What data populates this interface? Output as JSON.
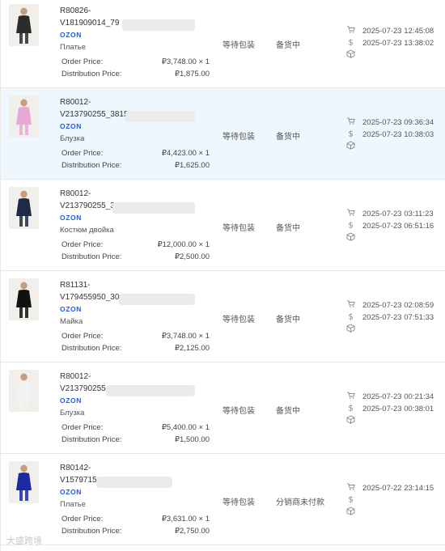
{
  "watermark": "大盛跨境",
  "orders": [
    {
      "sku_line1": "R80826-",
      "sku_line2": "V181909014_79",
      "platform": "OZON",
      "product_type": "Платье",
      "order_price_label": "Order Price:",
      "order_price": "₽3,748.00 × 1",
      "dist_price_label": "Distribution Price:",
      "dist_price": "₽1,875.00",
      "status": "等待包装",
      "stock_status": "备货中",
      "time_1": "2025-07-23 12:45:08",
      "time_2": "2025-07-23 13:38:02",
      "thumb_color": "#2b2b2b",
      "highlighted": false
    },
    {
      "sku_line1": "R80012-",
      "sku_line2": "V213790255_3815",
      "platform": "OZON",
      "product_type": "Блузка",
      "order_price_label": "Order Price:",
      "order_price": "₽4,423.00 × 1",
      "dist_price_label": "Distribution Price:",
      "dist_price": "₽1,625.00",
      "status": "等待包装",
      "stock_status": "备货中",
      "time_1": "2025-07-23 09:36:34",
      "time_2": "2025-07-23 10:38:03",
      "thumb_color": "#e7a9d4",
      "highlighted": true
    },
    {
      "sku_line1": "R80012-",
      "sku_line2": "V213790255_3",
      "platform": "OZON",
      "product_type": "Костюм двойка",
      "order_price_label": "Order Price:",
      "order_price": "₽12,000.00 × 1",
      "dist_price_label": "Distribution Price:",
      "dist_price": "₽2,500.00",
      "status": "等待包装",
      "stock_status": "备货中",
      "time_1": "2025-07-23 03:11:23",
      "time_2": "2025-07-23 06:51:16",
      "thumb_color": "#1f2a44",
      "highlighted": false
    },
    {
      "sku_line1": "R81131-",
      "sku_line2": "V179455950_30",
      "platform": "OZON",
      "product_type": "Майка",
      "order_price_label": "Order Price:",
      "order_price": "₽3,748.00 × 1",
      "dist_price_label": "Distribution Price:",
      "dist_price": "₽2,125.00",
      "status": "等待包装",
      "stock_status": "备货中",
      "time_1": "2025-07-23 02:08:59",
      "time_2": "2025-07-23 07:51:33",
      "thumb_color": "#111111",
      "highlighted": false
    },
    {
      "sku_line1": "R80012-",
      "sku_line2": "V213790255",
      "platform": "OZON",
      "product_type": "Блузка",
      "order_price_label": "Order Price:",
      "order_price": "₽5,400.00 × 1",
      "dist_price_label": "Distribution Price:",
      "dist_price": "₽1,500.00",
      "status": "等待包装",
      "stock_status": "备货中",
      "time_1": "2025-07-23 00:21:34",
      "time_2": "2025-07-23 00:38:01",
      "thumb_color": "#f2f2f2",
      "highlighted": false
    },
    {
      "sku_line1": "R80142-",
      "sku_line2": "V1579715",
      "platform": "OZON",
      "product_type": "Платье",
      "order_price_label": "Order Price:",
      "order_price": "₽3,631.00 × 1",
      "dist_price_label": "Distribution Price:",
      "dist_price": "₽2,750.00",
      "status": "等待包装",
      "stock_status": "分销商未付款",
      "time_1": "2025-07-22 23:14:15",
      "time_2": "",
      "thumb_color": "#1c2aa6",
      "highlighted": false
    }
  ],
  "icons": {
    "cart": "cart-icon",
    "price": "dollar-icon",
    "package": "package-icon"
  }
}
